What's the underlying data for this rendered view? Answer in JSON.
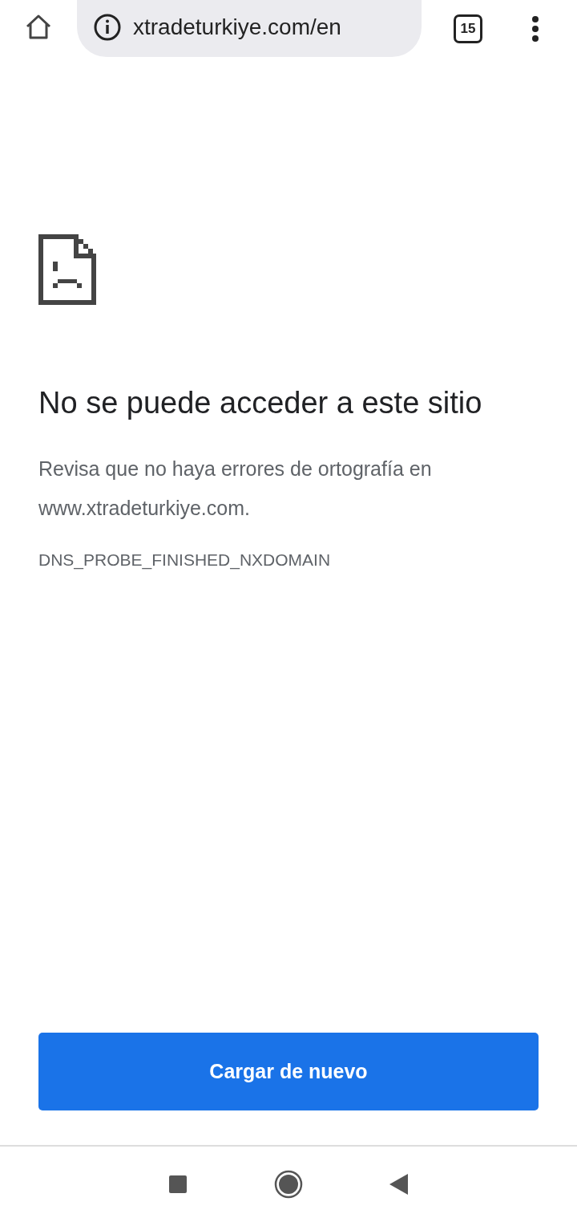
{
  "toolbar": {
    "url": "xtradeturkiye.com/en",
    "tab_count": "15"
  },
  "error": {
    "title": "No se puede acceder a este sitio",
    "message": "Revisa que no haya errores de ortografía en www.xtradeturkiye.com.",
    "code": "DNS_PROBE_FINISHED_NXDOMAIN"
  },
  "reload_button": "Cargar de nuevo"
}
